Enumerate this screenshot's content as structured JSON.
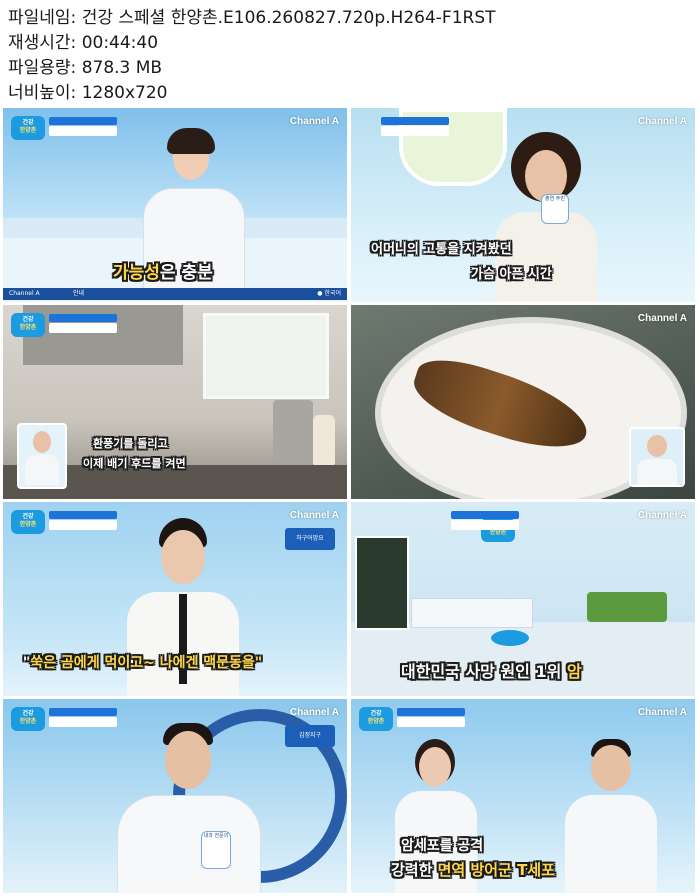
{
  "file_info": {
    "filename_line": "파일네임: 건강 스페셜 한양촌.E106.260827.720p.H264-F1RST",
    "duration_line": "재생시간: 00:44:40",
    "filesize_line": "파일용량: 878.3 MB",
    "resolution_line": "너비높이: 1280x720"
  },
  "channel_logo": "Channel A",
  "frames": [
    {
      "subtitle_a": "가능성",
      "subtitle_b": "은 충분",
      "ticker_left": "Channel A",
      "ticker_mid": "안내",
      "ticker_right": "● 한국어"
    },
    {
      "subtitle_line1": "어머니의 고통을 지켜봤던",
      "subtitle_line2": "가슴 아픈 시간",
      "nametag": "출연 주민"
    },
    {
      "subtitle_line1": "환풍기를 돌리고",
      "subtitle_line2": "이제 배기 후드를 켜면"
    },
    {},
    {
      "caption_box": "하구어망요",
      "subtitle_part1": "\"",
      "subtitle_part2": "쑥은 곰에게 먹이고~ 나에겐 ",
      "subtitle_part3": "맥문동을\""
    },
    {
      "subtitle_part1": "대한민국 사망 원인 1위 ",
      "subtitle_part2": "암"
    },
    {
      "caption_box": "김정지구",
      "nametag": "내과 전문의"
    },
    {
      "subtitle_line1": "암세포를 공격",
      "subtitle_line2a": "강력한 ",
      "subtitle_line2b": "면역 방어군 T세포"
    }
  ]
}
